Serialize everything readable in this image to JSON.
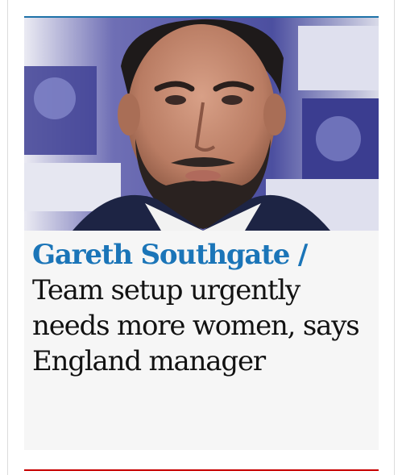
{
  "article": {
    "image": {
      "icon": "portrait-photo",
      "subject": "man in suit with beard"
    },
    "kicker": "Gareth Southgate /",
    "headline": "Team setup urgently needs more women, says England manager"
  },
  "colors": {
    "kicker": "#1b75b8",
    "headline": "#121212",
    "card_background": "#f6f6f6",
    "top_accent": "#1e72a8",
    "bottom_accent": "#c70000"
  }
}
